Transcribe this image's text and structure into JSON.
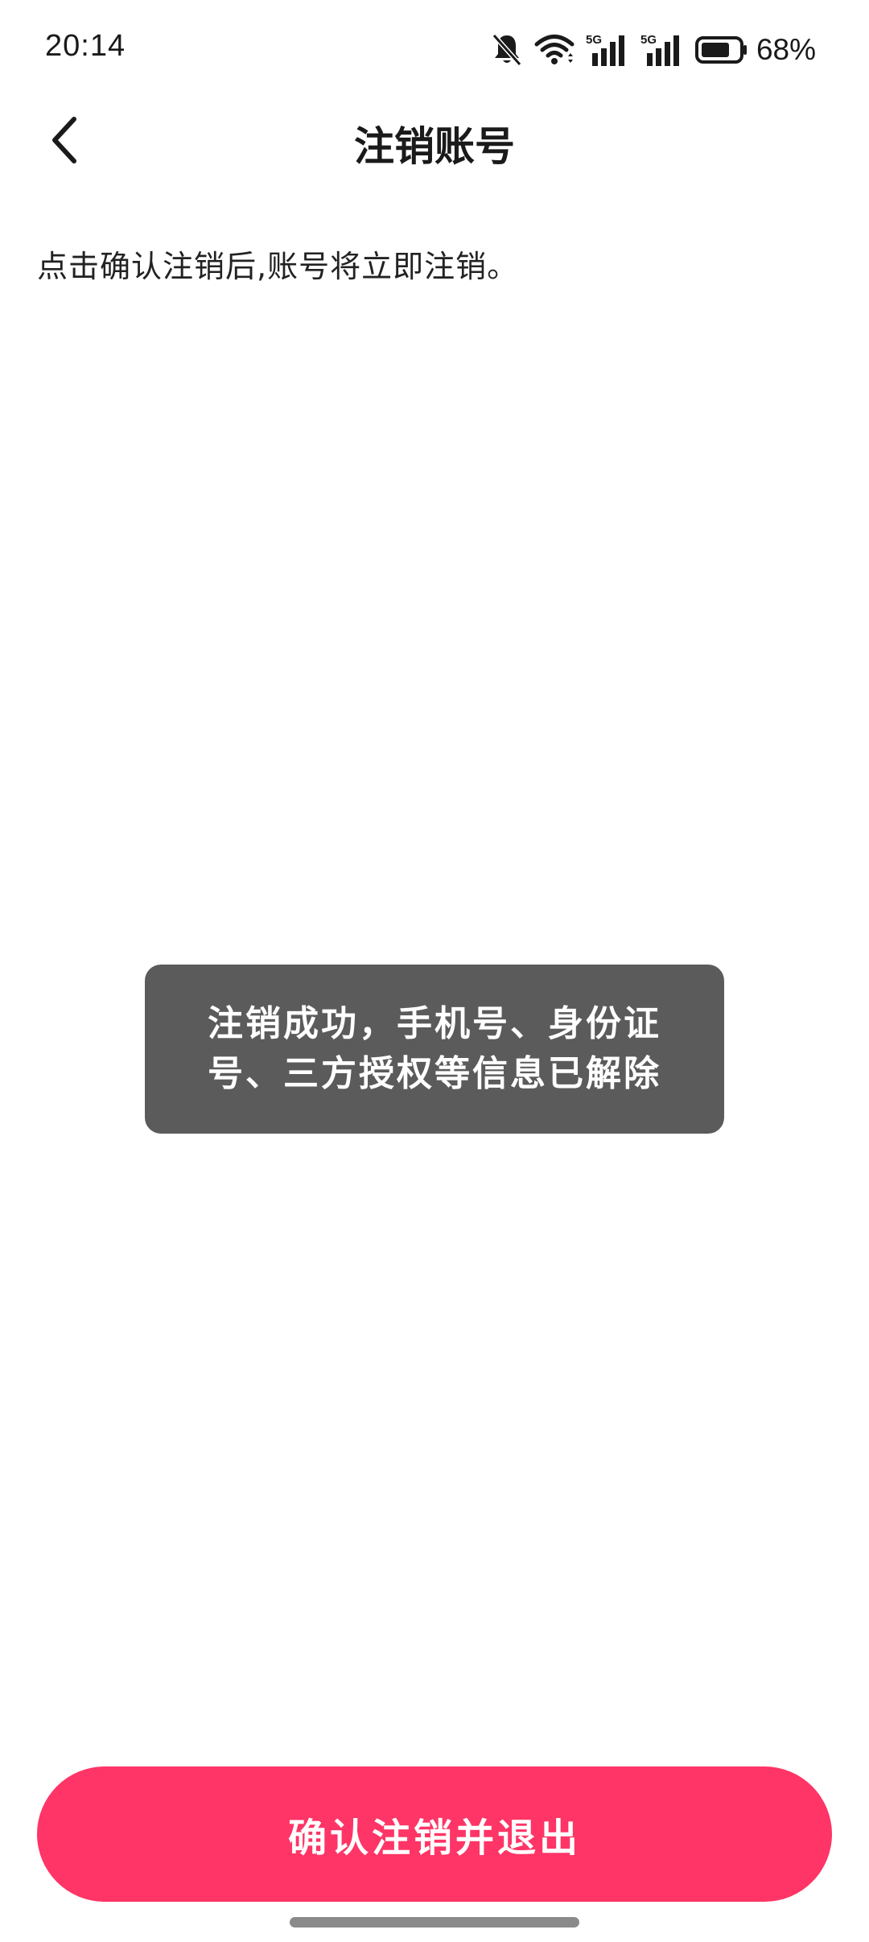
{
  "status_bar": {
    "time": "20:14",
    "icons": [
      "bell-off-icon",
      "wifi-icon",
      "5g-signal-icon",
      "5g-signal-icon",
      "battery-icon"
    ],
    "signal_label_1": "5G",
    "signal_label_2": "5G",
    "battery_percent": "68%"
  },
  "header": {
    "back_icon": "chevron-left-icon",
    "title": "注销账号"
  },
  "main": {
    "description": "点击确认注销后,账号将立即注销。"
  },
  "toast": {
    "message": "注销成功，手机号、身份证号、三方授权等信息已解除"
  },
  "footer": {
    "confirm_label": "确认注销并退出"
  },
  "colors": {
    "accent": "#fe3566",
    "toast_bg": "#5b5b5b",
    "text": "#1a1a1a",
    "background": "#ffffff"
  }
}
